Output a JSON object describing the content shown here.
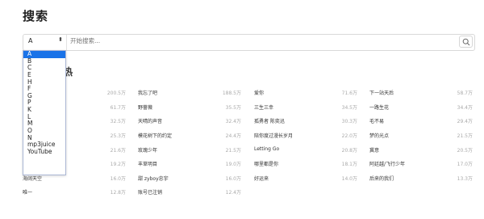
{
  "page": {
    "title": "搜索"
  },
  "search": {
    "selected": "A",
    "placeholder": "开始搜索...",
    "options": [
      "A",
      "B",
      "C",
      "E",
      "H",
      "F",
      "G",
      "P",
      "K",
      "L",
      "M",
      "O",
      "N",
      "mp3juice",
      "YouTube"
    ]
  },
  "trending": {
    "heading": "热",
    "columns": [
      [
        {
          "name": "",
          "count": "200.5万"
        },
        {
          "name": "",
          "count": "61.7万"
        },
        {
          "name": "",
          "count": "32.5万"
        },
        {
          "name": "",
          "count": "25.3万"
        },
        {
          "name": "",
          "count": "21.6万"
        },
        {
          "name": "",
          "count": "19.2万"
        },
        {
          "name": "海阔天空",
          "count": "16.0万"
        },
        {
          "name": "唯一",
          "count": "12.8万"
        }
      ],
      [
        {
          "name": "我忘了吧",
          "count": "188.5万"
        },
        {
          "name": "野蔷薇",
          "count": "35.5万"
        },
        {
          "name": "天晴的声音",
          "count": "32.4万"
        },
        {
          "name": "模花树下的约定",
          "count": "24.4万"
        },
        {
          "name": "玫瑰少年",
          "count": "21.5万"
        },
        {
          "name": "丰草明目",
          "count": "19.0万"
        },
        {
          "name": "甜 zyboy忠宇",
          "count": "16.0万"
        },
        {
          "name": "账号已注销",
          "count": "12.4万"
        }
      ],
      [
        {
          "name": "爱你",
          "count": "71.6万"
        },
        {
          "name": "三生三幸",
          "count": "34.5万"
        },
        {
          "name": "孤勇者 陈奕迅",
          "count": "30.3万"
        },
        {
          "name": "陪你度过漫长岁月",
          "count": "22.0万"
        },
        {
          "name": "Letting Go",
          "count": "20.8万"
        },
        {
          "name": "哪里都是你",
          "count": "18.1万"
        },
        {
          "name": "好运来",
          "count": "14.0万"
        }
      ],
      [
        {
          "name": "下一站天后",
          "count": "58.7万"
        },
        {
          "name": "一路生花",
          "count": "34.4万"
        },
        {
          "name": "毛不易",
          "count": "29.4万"
        },
        {
          "name": "梦的光点",
          "count": "21.5万"
        },
        {
          "name": "冀意",
          "count": "20.5万"
        },
        {
          "name": "阿廷越/飞行少年",
          "count": "17.0万"
        },
        {
          "name": "后来的我们",
          "count": "13.3万"
        }
      ]
    ]
  },
  "colors": {
    "selected_option": "#1a73e8",
    "count_text": "#aaaaaa"
  }
}
